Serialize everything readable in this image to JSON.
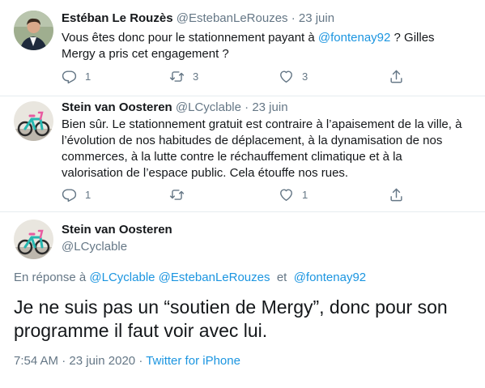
{
  "tweets": [
    {
      "author_name": "Estéban Le Rouzès",
      "handle": "@EstebanLeRouzes",
      "separator": "·",
      "date": "23 juin",
      "text_line1_pre": "Vous êtes donc pour le stationnement payant à ",
      "text_line1_mention": "@fontenay92",
      "text_line1_post": " ? Gilles",
      "text_line2": "Mergy a pris cet engagement ?",
      "reply_count": "1",
      "retweet_count": "3",
      "like_count": "3"
    },
    {
      "author_name": "Stein van Oosteren",
      "handle": "@LCyclable",
      "separator": "·",
      "date": "23 juin",
      "text_lines": [
        "Bien sûr. Le stationnement gratuit est contraire à l’apaisement de la ville, à",
        "l’évolution de nos habitudes de déplacement, à la dynamisation de nos",
        "commerces, à la lutte contre le réchauffement climatique et à la",
        "valorisation de l’espace public. Cela étouffe nos rues."
      ],
      "reply_count": "1",
      "retweet_count": "",
      "like_count": "1"
    }
  ],
  "main_tweet": {
    "author_name": "Stein van Oosteren",
    "handle": "@LCyclable",
    "reply_prefix": "En réponse à",
    "reply_mention1": "@LCyclable",
    "reply_mention2": "@EstebanLeRouzes",
    "reply_and": "et",
    "reply_mention3": "@fontenay92",
    "text_line1": "Je ne suis pas un “soutien de Mergy”, donc pour son",
    "text_line2": "programme il faut voir avec lui.",
    "time": "7:54 AM",
    "separator": "·",
    "date": "23 juin 2020",
    "source": "Twitter for iPhone"
  },
  "icons": {
    "reply": "reply-icon",
    "retweet": "retweet-icon",
    "like": "heart-icon",
    "share": "share-icon"
  },
  "colors": {
    "link": "#1b95e0",
    "muted": "#657786",
    "text": "#14171a"
  }
}
